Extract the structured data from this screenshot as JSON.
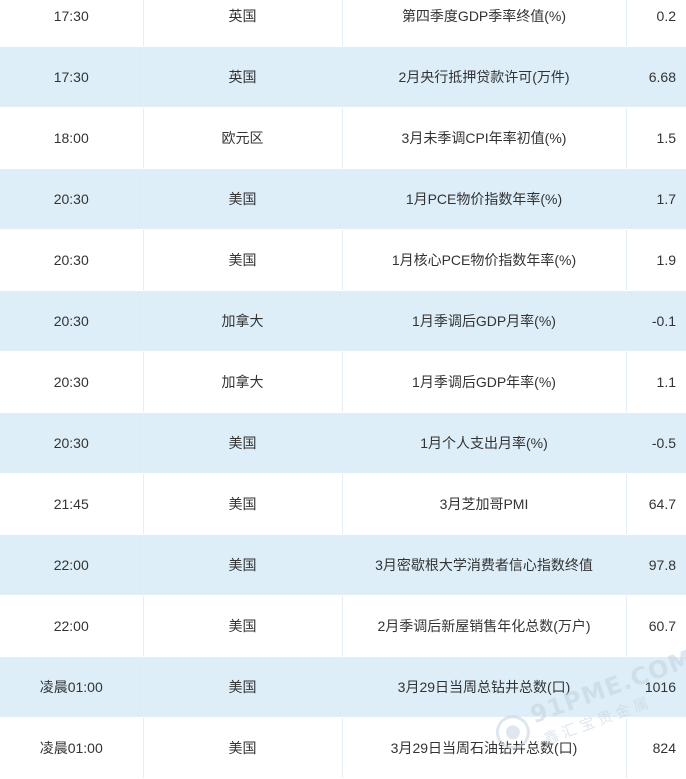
{
  "rows": [
    {
      "time": "17:30",
      "country": "英国",
      "event": "第四季度GDP季率终值(%)",
      "value": "0.2"
    },
    {
      "time": "17:30",
      "country": "英国",
      "event": "2月央行抵押贷款许可(万件)",
      "value": "6.68"
    },
    {
      "time": "18:00",
      "country": "欧元区",
      "event": "3月未季调CPI年率初值(%)",
      "value": "1.5"
    },
    {
      "time": "20:30",
      "country": "美国",
      "event": "1月PCE物价指数年率(%)",
      "value": "1.7"
    },
    {
      "time": "20:30",
      "country": "美国",
      "event": "1月核心PCE物价指数年率(%)",
      "value": "1.9"
    },
    {
      "time": "20:30",
      "country": "加拿大",
      "event": "1月季调后GDP月率(%)",
      "value": "-0.1"
    },
    {
      "time": "20:30",
      "country": "加拿大",
      "event": "1月季调后GDP年率(%)",
      "value": "1.1"
    },
    {
      "time": "20:30",
      "country": "美国",
      "event": "1月个人支出月率(%)",
      "value": "-0.5"
    },
    {
      "time": "21:45",
      "country": "美国",
      "event": "3月芝加哥PMI",
      "value": "64.7"
    },
    {
      "time": "22:00",
      "country": "美国",
      "event": "3月密歇根大学消费者信心指数终值",
      "value": "97.8"
    },
    {
      "time": "22:00",
      "country": "美国",
      "event": "2月季调后新屋销售年化总数(万户)",
      "value": "60.7"
    },
    {
      "time": "凌晨01:00",
      "country": "美国",
      "event": "3月29日当周总钻井总数(口)",
      "value": "1016"
    },
    {
      "time": "凌晨01:00",
      "country": "美国",
      "event": "3月29日当周石油钻井总数(口)",
      "value": "824"
    }
  ],
  "watermark": {
    "main": "91PME.COM",
    "sub": "鑫汇宝贵金属"
  },
  "colors": {
    "row_alt": "#ddeef8",
    "row_plain": "#ffffff",
    "text": "#333333",
    "watermark": "#c5d3df"
  }
}
